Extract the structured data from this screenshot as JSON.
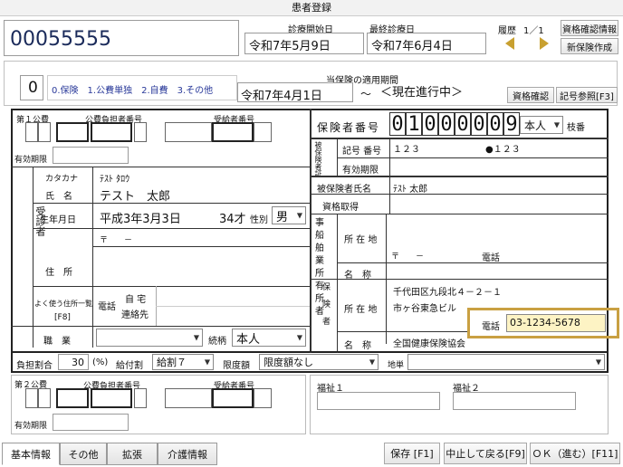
{
  "window": {
    "title": "患者登録"
  },
  "top": {
    "patient_id": "00055555",
    "start_label": "診療開始日",
    "start_date": "令和7年5月9日",
    "last_label": "最終診療日",
    "last_date": "令和7年6月4日",
    "history_label": "履歴",
    "history_page": "1／1",
    "btn_qual_info": "資格確認情報",
    "btn_new_insurance": "新保険作成"
  },
  "insurance_head": {
    "type_value": "0",
    "type_options": "0.保険　1.公費単独　2.自費　3.その他",
    "period_label": "当保険の適用期間",
    "period_start": "令和7年4月1日",
    "period_tilde": "～",
    "period_end": "＜現在進行中＞",
    "btn_qual_check": "資格確認",
    "btn_record_ref": "記号参照[F3]"
  },
  "kohi1": {
    "title": "第１公費",
    "payer_label": "公費負担者番号",
    "recipient_label": "受給者番号",
    "expiry_label": "有効期限"
  },
  "insured": {
    "number_label": "保険者番号",
    "digits": [
      "0",
      "1",
      "0",
      "0",
      "0",
      "0",
      "0",
      "9"
    ],
    "relation": "本人",
    "branch_label": "枝番",
    "vertical_label": "被保険者証",
    "symbol_label": "記号 番号",
    "symbol_value": "１２３",
    "number_value": "●１２３",
    "expiry_label": "有効期限",
    "name_label": "被保険者氏名",
    "name_value": "ﾃｽﾄ 太郎",
    "acquired_label": "資格取得",
    "office_label": "事船舶業所有所者",
    "office_address_label": "所 在 地",
    "office_postal": "〒　　－",
    "office_phone_label": "電話",
    "office_name_label": "名　称",
    "insurer_label": "保険者",
    "insurer_address_label": "所 在 地",
    "insurer_address1": "千代田区九段北４－２－１",
    "insurer_address2": "市ヶ谷東急ビル",
    "insurer_phone_label": "電話",
    "insurer_phone": "03-1234-5678",
    "insurer_name_label": "名　称",
    "insurer_name": "全国健康保険協会"
  },
  "patient": {
    "section_label": "受診者",
    "kana_label": "カタカナ",
    "kana_value": "ﾃｽﾄ ﾀﾛｳ",
    "name_label": "氏　名",
    "name_value": "テスト　太郎",
    "dob_label": "生年月日",
    "dob_value": "平成3年3月3日",
    "age": "34才",
    "sex_label": "性別",
    "sex_value": "男",
    "address_label": "住　所",
    "postal": "〒　　－",
    "frequent_label": "よく使う住所一覧",
    "frequent_key": "[F8]",
    "phone_label": "電話",
    "phone_home": "自 宅",
    "phone_contact": "連絡先",
    "job_label": "職　業",
    "relation_label": "続柄",
    "relation_value": "本人"
  },
  "burden": {
    "ratio_label": "負担割合",
    "ratio_value": "30",
    "ratio_unit": "(%)",
    "benefit_label": "給付割",
    "benefit_value": "給割７",
    "limit_label": "限度額",
    "limit_value": "限度額なし",
    "region_label": "地単"
  },
  "kohi2": {
    "title": "第２公費",
    "payer_label": "公費負担者番号",
    "recipient_label": "受給者番号",
    "expiry_label": "有効期限"
  },
  "welfare": {
    "w1": "福祉１",
    "w2": "福祉２"
  },
  "tabs": [
    "基本情報",
    "その他",
    "拡張",
    "介護情報"
  ],
  "footer": {
    "save": "保存 [F1]",
    "cancel": "中止して戻る[F9]",
    "ok": "ＯＫ（進む）[F11]"
  },
  "colors": {
    "highlight_border": "#c9a042",
    "phone_bg": "#fdf3c4",
    "nav_arrow": "#c8a030"
  }
}
